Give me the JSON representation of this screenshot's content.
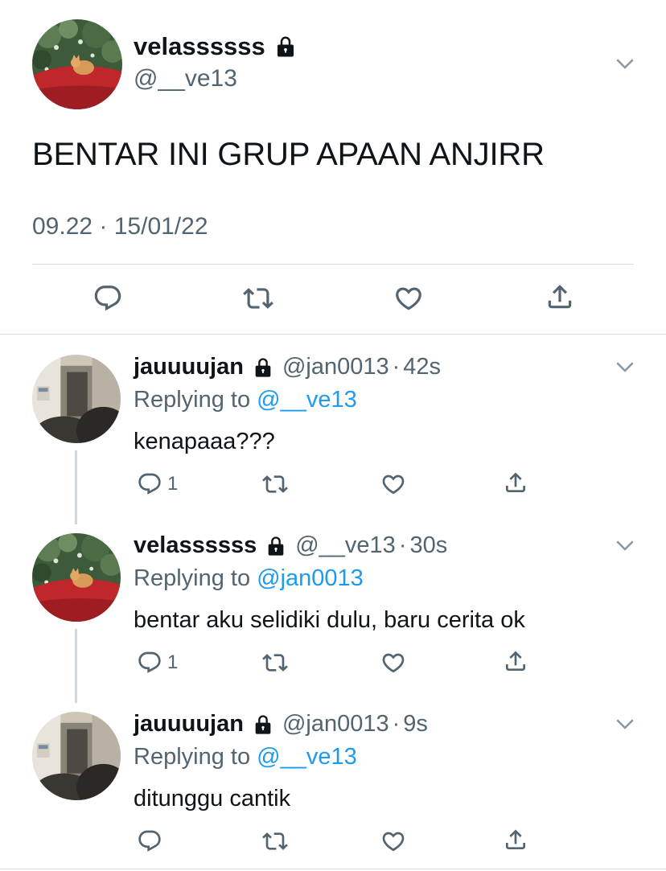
{
  "main_tweet": {
    "display_name": "velassssss",
    "handle": "@__ve13",
    "text": "BENTAR INI GRUP APAAN ANJIRR",
    "timestamp": "09.22 · 15/01/22",
    "avatar_icon": "avatar-cat-on-red-car"
  },
  "replies": [
    {
      "display_name": "jauuuujan",
      "handle": "@jan0013",
      "dot": "·",
      "time": "42s",
      "replying_prefix": "Replying to ",
      "replying_to": "@__ve13",
      "text": "kenapaaa???",
      "reply_count": "1",
      "avatar_icon": "avatar-room-doorway"
    },
    {
      "display_name": "velassssss",
      "handle": "@__ve13",
      "dot": "·",
      "time": "30s",
      "replying_prefix": "Replying to ",
      "replying_to": "@jan0013",
      "text": "bentar aku selidiki dulu, baru cerita ok",
      "reply_count": "1",
      "avatar_icon": "avatar-cat-on-red-car"
    },
    {
      "display_name": "jauuuujan",
      "handle": "@jan0013",
      "dot": "·",
      "time": "9s",
      "replying_prefix": "Replying to ",
      "replying_to": "@__ve13",
      "text": "ditunggu cantik",
      "reply_count": "",
      "avatar_icon": "avatar-room-doorway"
    }
  ],
  "icons": {
    "reply": "reply-icon",
    "retweet": "retweet-icon",
    "like": "like-icon",
    "share": "share-icon",
    "lock": "lock-icon",
    "more": "chevron-down-icon"
  },
  "colors": {
    "text": "#0f1419",
    "secondary": "#536471",
    "link": "#1d9bf0",
    "divider": "#d9dde1",
    "thread_line": "#cfd9de"
  }
}
